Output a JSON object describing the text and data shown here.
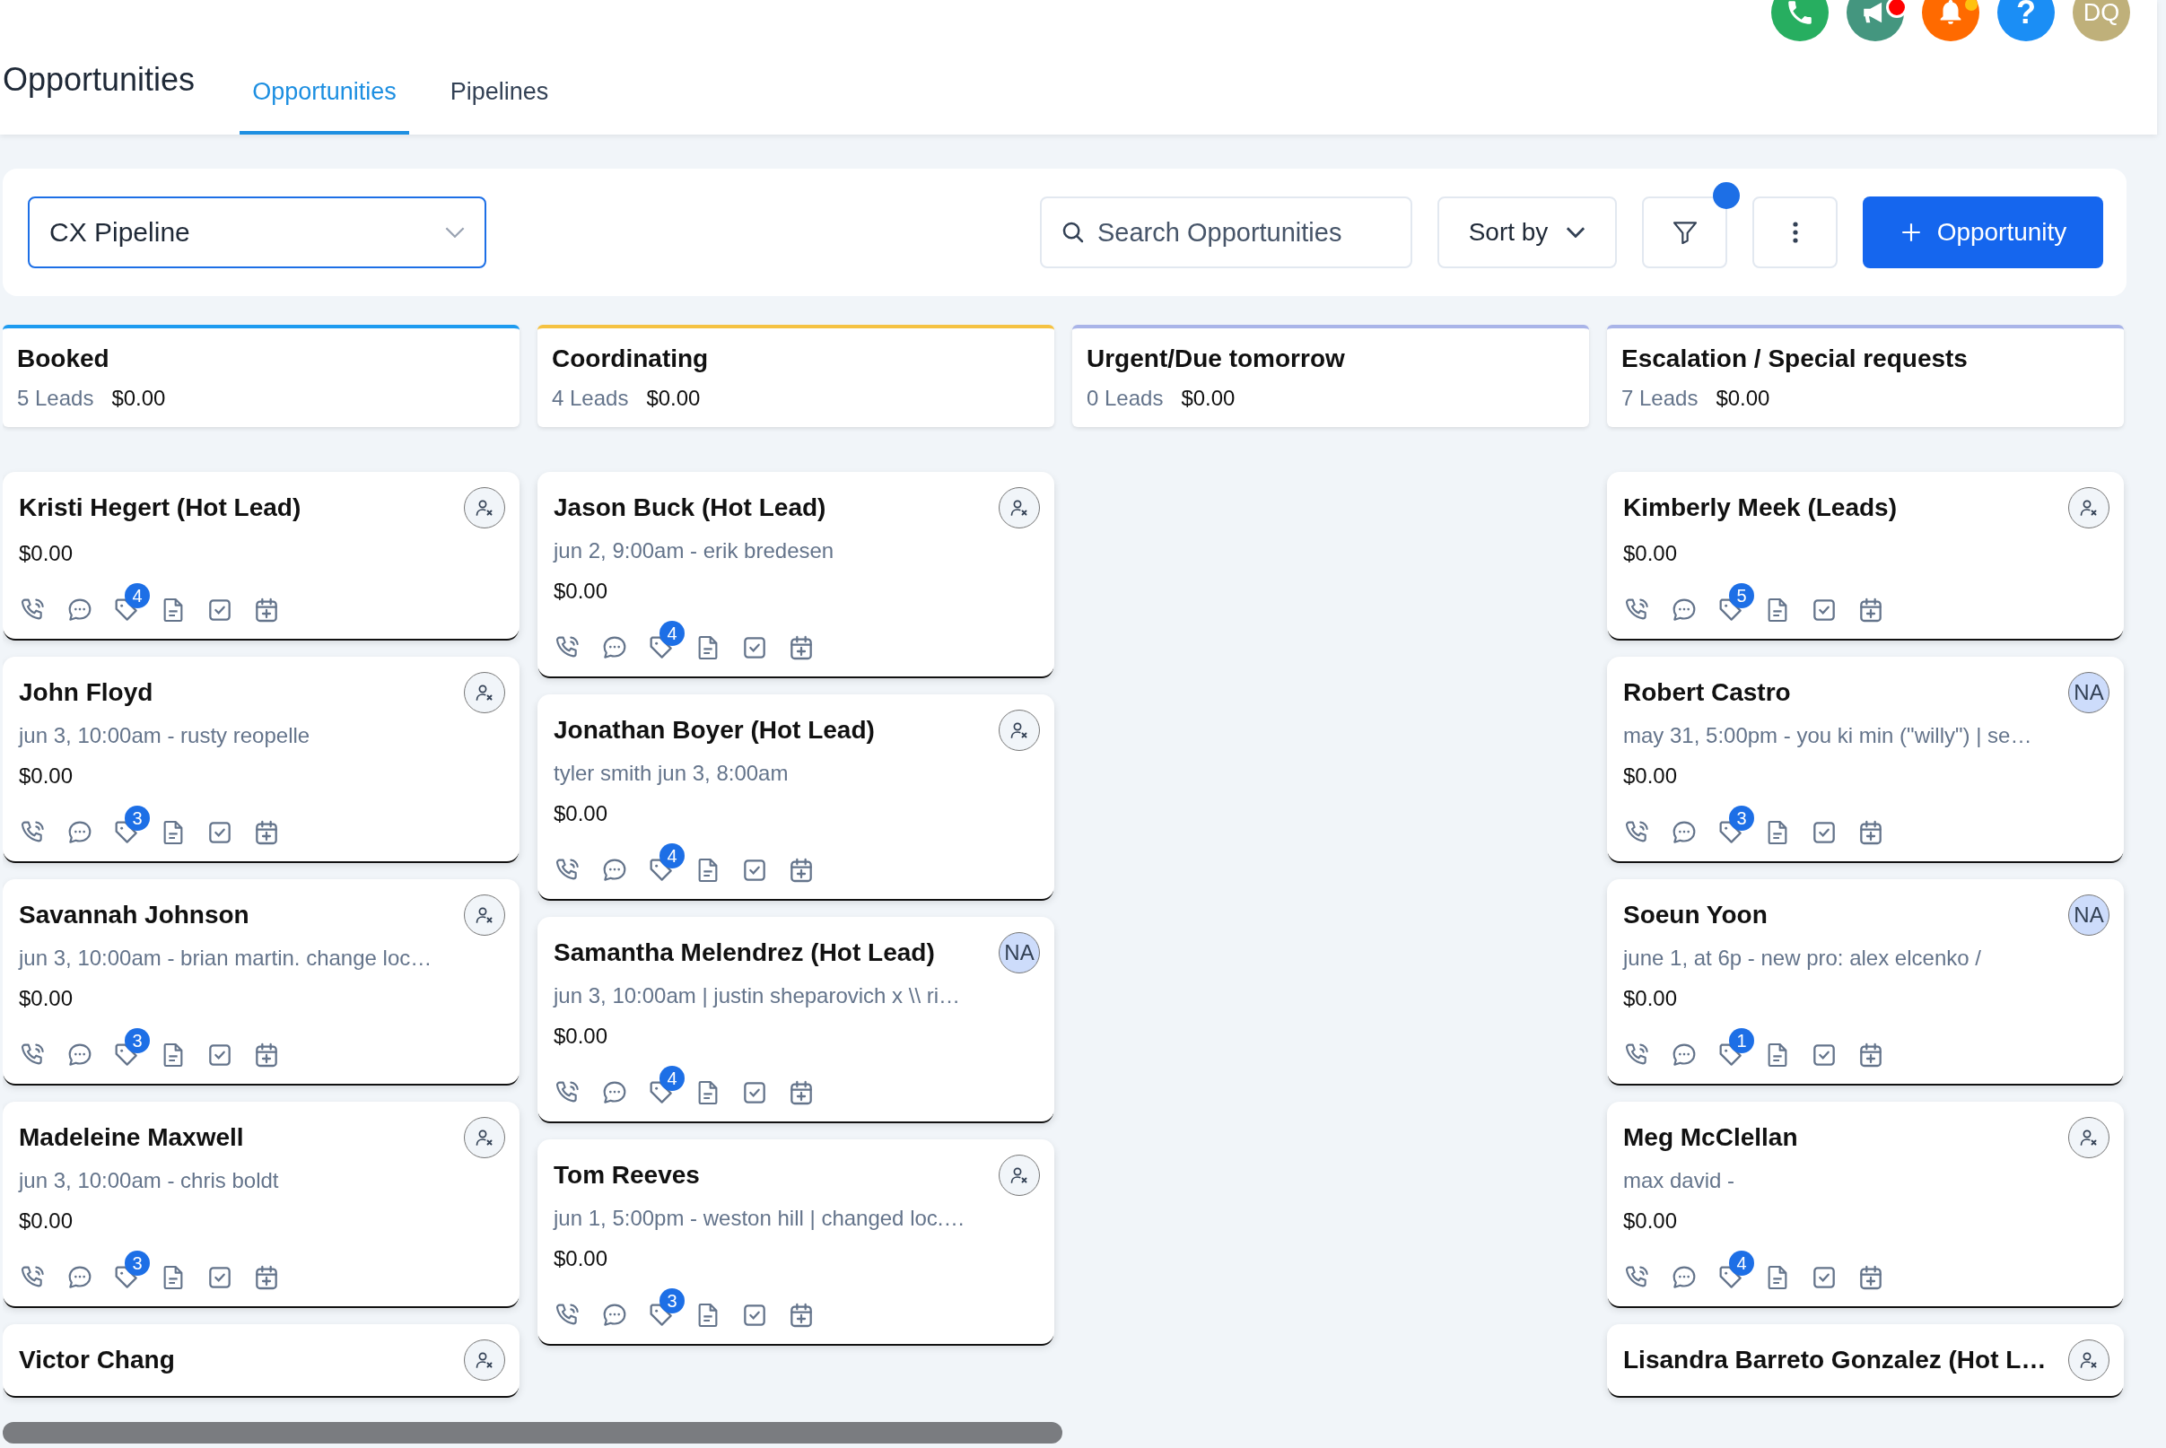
{
  "header": {
    "title": "Opportunities",
    "tabs": [
      {
        "label": "Opportunities",
        "selected": true
      },
      {
        "label": "Pipelines",
        "selected": false
      }
    ],
    "top_icons": [
      {
        "kind": "phone",
        "color": "#27ae60"
      },
      {
        "kind": "megaphone",
        "color": "#44967f",
        "dot": true
      },
      {
        "kind": "bell",
        "color": "#ff6a00",
        "dot": true
      },
      {
        "kind": "help",
        "color": "#1b8ef5",
        "label": "?"
      },
      {
        "kind": "avatar",
        "color": "#bfb07a",
        "label": "DQ"
      }
    ]
  },
  "toolbar": {
    "pipeline": "CX Pipeline",
    "search": {
      "placeholder": "Search Opportunities"
    },
    "sort": "Sort by",
    "filter": {
      "active": true
    },
    "add_button": "Opportunity"
  },
  "columns": [
    {
      "title": "Booked",
      "color": "#1e9bf0",
      "leads": "5 Leads",
      "amount": "$0.00",
      "cards": [
        {
          "name": "Kristi Hegert (Hot Lead)",
          "amount": "$0.00",
          "tags": "4",
          "assignee": {
            "kind": "unassigned"
          }
        },
        {
          "name": "John Floyd",
          "subtitle": "jun 3, 10:00am - rusty reopelle",
          "amount": "$0.00",
          "tags": "3",
          "assignee": {
            "kind": "unassigned"
          }
        },
        {
          "name": "Savannah Johnson",
          "subtitle": "jun 3, 10:00am - brian martin. change loc…",
          "amount": "$0.00",
          "tags": "3",
          "assignee": {
            "kind": "unassigned"
          }
        },
        {
          "name": "Madeleine Maxwell",
          "subtitle": "jun 3, 10:00am - chris boldt",
          "amount": "$0.00",
          "tags": "3",
          "assignee": {
            "kind": "unassigned"
          }
        },
        {
          "name": "Victor Chang",
          "assignee": {
            "kind": "unassigned"
          }
        }
      ]
    },
    {
      "title": "Coordinating",
      "color": "#f5c242",
      "leads": "4 Leads",
      "amount": "$0.00",
      "cards": [
        {
          "name": "Jason Buck (Hot Lead)",
          "subtitle": "jun 2, 9:00am - erik bredesen",
          "amount": "$0.00",
          "tags": "4",
          "assignee": {
            "kind": "unassigned"
          }
        },
        {
          "name": "Jonathan Boyer (Hot Lead)",
          "subtitle": "tyler smith jun 3, 8:00am",
          "amount": "$0.00",
          "tags": "4",
          "assignee": {
            "kind": "unassigned"
          }
        },
        {
          "name": "Samantha Melendrez (Hot Lead)",
          "subtitle": "jun 3, 10:00am | justin sheparovich x \\\\ ri…",
          "amount": "$0.00",
          "tags": "4",
          "assignee": {
            "kind": "initials",
            "initials": "NA"
          }
        },
        {
          "name": "Tom Reeves",
          "subtitle": "jun 1, 5:00pm - weston hill | changed loc.…",
          "amount": "$0.00",
          "tags": "3",
          "assignee": {
            "kind": "unassigned"
          }
        }
      ]
    },
    {
      "title": "Urgent/Due tomorrow",
      "color": "#a9b4e8",
      "leads": "0 Leads",
      "amount": "$0.00"
    },
    {
      "title": "Escalation / Special requests",
      "color": "#a9b4e8",
      "leads": "7 Leads",
      "amount": "$0.00",
      "cards": [
        {
          "name": "Kimberly Meek (Leads)",
          "amount": "$0.00",
          "tags": "5",
          "assignee": {
            "kind": "unassigned"
          }
        },
        {
          "name": "Robert Castro",
          "subtitle": "may 31, 5:00pm - you ki min (\"willy\") | se…",
          "amount": "$0.00",
          "tags": "3",
          "assignee": {
            "kind": "initials",
            "initials": "NA"
          }
        },
        {
          "name": "Soeun Yoon",
          "subtitle": "june 1, at 6p - new pro: alex elcenko /",
          "amount": "$0.00",
          "tags": "1",
          "assignee": {
            "kind": "initials",
            "initials": "NA"
          }
        },
        {
          "name": "Meg McClellan",
          "subtitle": "max david -",
          "amount": "$0.00",
          "tags": "4",
          "assignee": {
            "kind": "unassigned"
          }
        },
        {
          "name": "Lisandra Barreto Gonzalez (Hot L…",
          "assignee": {
            "kind": "unassigned"
          }
        }
      ]
    }
  ]
}
